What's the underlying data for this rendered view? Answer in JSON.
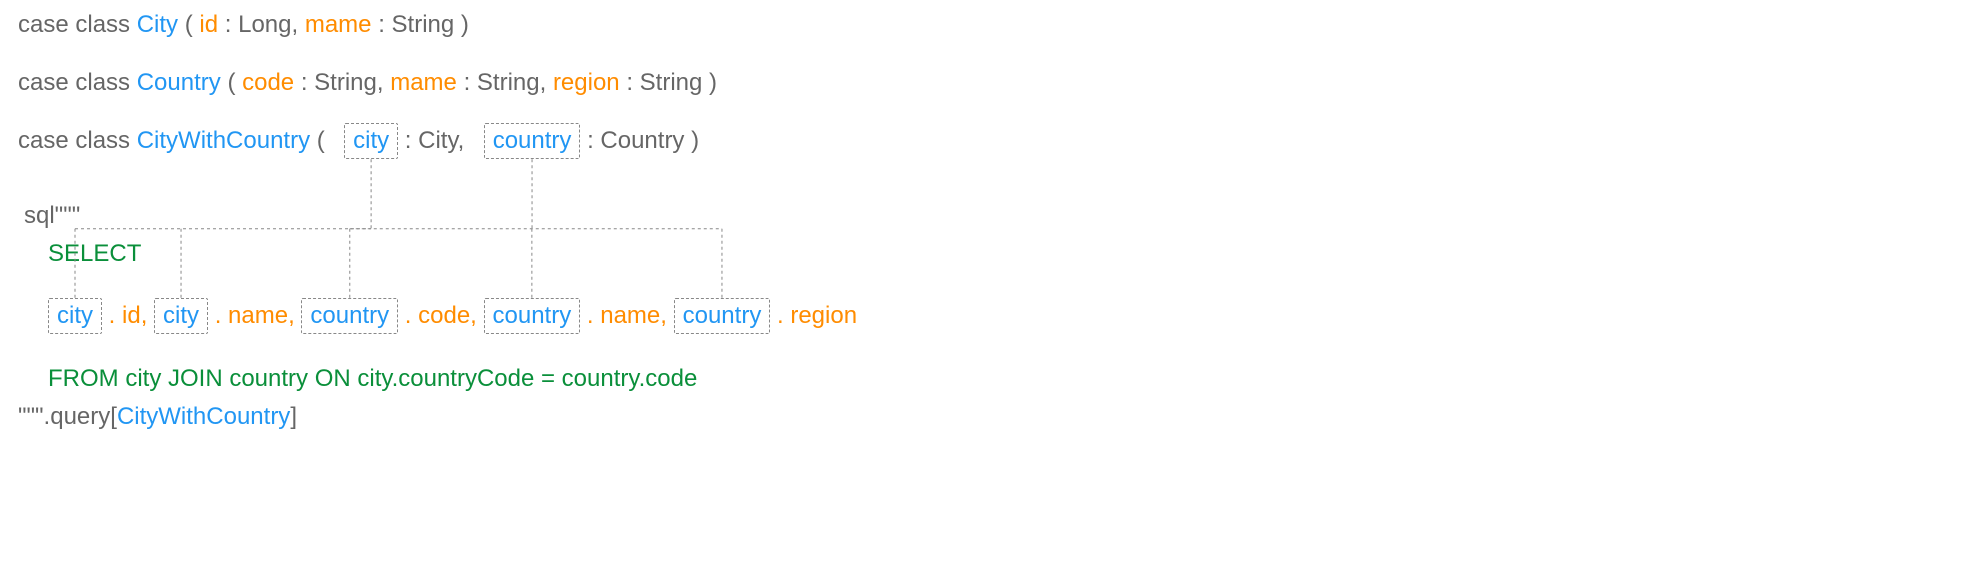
{
  "classes": {
    "city": {
      "kw": "case class",
      "name": "City",
      "open": "(",
      "id_label": "id",
      "id_type": ": Long,  ",
      "mame_label": "mame",
      "mame_type": ": String )"
    },
    "country": {
      "kw": "case class",
      "name": "Country",
      "open": "(",
      "code_label": "code",
      "code_type": ": String,  ",
      "mame_label": "mame",
      "mame_type": ": String,  ",
      "region_label": "region",
      "region_type": ":  String )"
    },
    "cwc": {
      "kw": "case class",
      "name": "CityWithCountry",
      "open": "(",
      "city_label": "city",
      "city_type": ": City,",
      "country_label": "country",
      "country_type": ": Country )"
    }
  },
  "sql": {
    "open": "sql\"\"\"",
    "select": "SELECT",
    "city_id_tbl": "city",
    "dot_id": ". id, ",
    "city_name_tbl": "city",
    "dot_name": ". name, ",
    "country_code_tbl": "country",
    "dot_code": ". code, ",
    "country_name_tbl": "country",
    "dot_name2": ". name, ",
    "country_region_tbl": "country",
    "dot_region": ". region",
    "from": "FROM city JOIN country ON city.countryCode = country.code",
    "close": "\"\"\".query[",
    "qtype": "CityWithCountry",
    "bracket": "]"
  }
}
